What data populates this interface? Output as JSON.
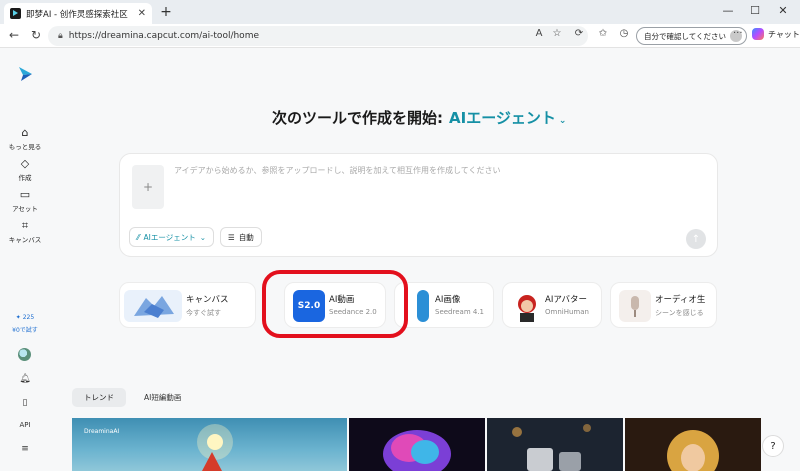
{
  "browser": {
    "tab_title": "即梦AI - 创作灵感探索社区",
    "tab_close": "✕",
    "new_tab": "+",
    "window_controls": [
      "—",
      "☐",
      "✕"
    ],
    "url": "https://dreamina.capcut.com/ai-tool/home",
    "signin_label": "自分で確認してください",
    "copilot_label": "チャット"
  },
  "sidebar": {
    "items": [
      {
        "icon": "home-icon",
        "label": "もっと見る"
      },
      {
        "icon": "create-icon",
        "label": "作成"
      },
      {
        "icon": "folder-icon",
        "label": "アセット"
      },
      {
        "icon": "canvas-icon",
        "label": "キャンバス"
      }
    ],
    "credits_count": "225",
    "credits_cta": "¥0で試す",
    "api_label": "API"
  },
  "main": {
    "heading": "次のツールで作成を開始:",
    "heading_accent": "AIエージェント",
    "prompt": {
      "placeholder": "アイデアから始めるか、参照をアップロードし、説明を加えて相互作用を作成してください",
      "upload_symbol": "+",
      "agent_button": "AIエージェント",
      "auto_button": "自動"
    },
    "tools": [
      {
        "name": "キャンバス",
        "sub": "今すぐ試す"
      },
      {
        "name": "AI動画",
        "sub": "Seedance 2.0",
        "badge": "S2.0"
      },
      {
        "name": "AI画像",
        "sub": "Seedream 4.1"
      },
      {
        "name": "AIアバター",
        "sub": "OmniHuman"
      },
      {
        "name": "オーディオ生",
        "sub": "シーンを感じる"
      }
    ],
    "trend_tabs": [
      "トレンド",
      "AI短編動画"
    ],
    "gallery_watermark": "DreaminaAI"
  },
  "colors": {
    "accent": "#1590a5",
    "highlight": "#e3101d",
    "page_bg": "#f7f8f9"
  }
}
